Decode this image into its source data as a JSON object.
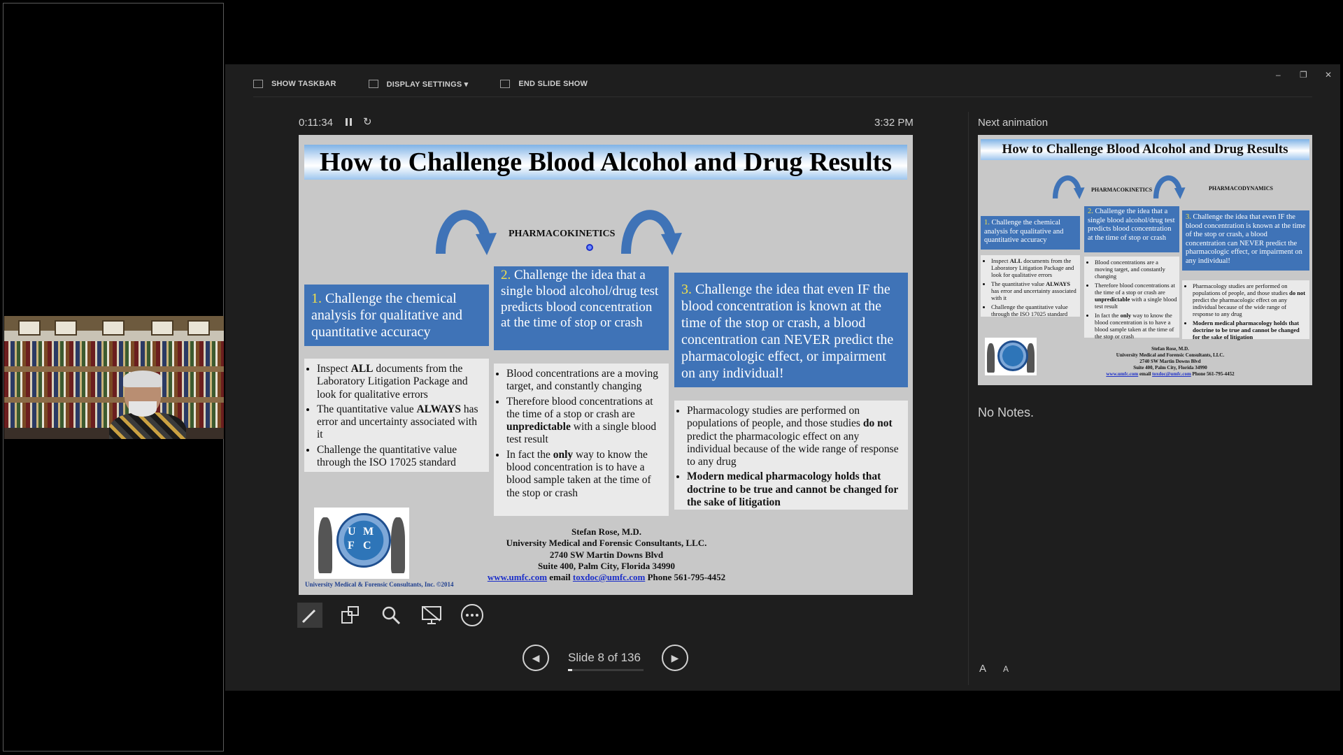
{
  "window": {
    "minimize": "–",
    "restore": "❐",
    "close": "✕"
  },
  "toolbar": {
    "show_taskbar": "SHOW TASKBAR",
    "display_settings": "DISPLAY SETTINGS ▾",
    "end_slide_show": "END SLIDE SHOW"
  },
  "status": {
    "timer": "0:11:34",
    "clock": "3:32 PM"
  },
  "slide": {
    "title": "How to Challenge Blood Alcohol and Drug Results",
    "pk_label": "PHARMACOKINETICS",
    "pd_label": "PHARMACODYNAMICS",
    "box1_num": "1.",
    "box1_text": "Challenge the chemical analysis for qualitative and quantitative accuracy",
    "box2_num": "2.",
    "box2_text": "Challenge the idea that a single blood alcohol/drug test predicts blood concentration at the time of stop or crash",
    "box3_num": "3.",
    "box3_text": "Challenge the idea that even IF the blood concentration is known at the time of the stop or crash, a blood concentration can NEVER predict the pharmacologic effect, or impairment on any individual!",
    "col1_bullets": [
      [
        "Inspect ",
        "ALL",
        " documents from the Laboratory Litigation Package and look for qualitative errors"
      ],
      [
        "The quantitative value ",
        "ALWAYS",
        " has error and uncertainty associated with it"
      ],
      [
        "Challenge the quantitative value through the ISO 17025 standard",
        "",
        ""
      ]
    ],
    "col2_bullets": [
      [
        "Blood concentrations are a moving target, and constantly changing",
        "",
        ""
      ],
      [
        "Therefore blood concentrations at the time of a stop or crash are ",
        "unpredictable",
        " with a single blood test result"
      ],
      [
        "In fact the ",
        "only",
        " way to know the blood concentration is to have a blood sample taken at the time of the stop or crash"
      ]
    ],
    "col3_bullets": [
      [
        "Pharmacology studies are performed on populations of people, and those studies ",
        "do not",
        " predict the pharmacologic effect on any individual because of the wide range of response to any drug"
      ],
      [
        "",
        "Modern medical pharmacology holds that doctrine to be true and cannot be changed for the sake of litigation",
        ""
      ]
    ],
    "credit_name": "Stefan Rose, M.D.",
    "credit_org": "University Medical and Forensic Consultants, LLC.",
    "credit_addr1": "2740 SW Martin Downs Blvd",
    "credit_addr2": "Suite 400, Palm City, Florida 34990",
    "credit_web": "www.umfc.com",
    "credit_email_label": "email",
    "credit_email": "toxdoc@umfc.com",
    "credit_phone": "Phone 561-795-4452",
    "logo_letters": [
      "U",
      "M",
      "F",
      "C"
    ],
    "logo_caption": "University Medical & Forensic Consultants, Inc. ©2014"
  },
  "navigation": {
    "slide_counter": "Slide 8 of 136",
    "current_slide": 8,
    "total_slides": 136,
    "prev_icon": "◀",
    "next_icon": "▶"
  },
  "tools": [
    "pen-tool",
    "see-all-slides",
    "zoom",
    "black-screen",
    "more-options"
  ],
  "right_pane": {
    "next_label": "Next animation",
    "notes": "No Notes.",
    "font_up": "A",
    "font_down": "A"
  },
  "colors": {
    "box_blue": "#3f73b7",
    "number_yellow": "#f4e14a",
    "slide_bg": "#c8c8c8",
    "presenter_bg": "#1e1e1e"
  }
}
